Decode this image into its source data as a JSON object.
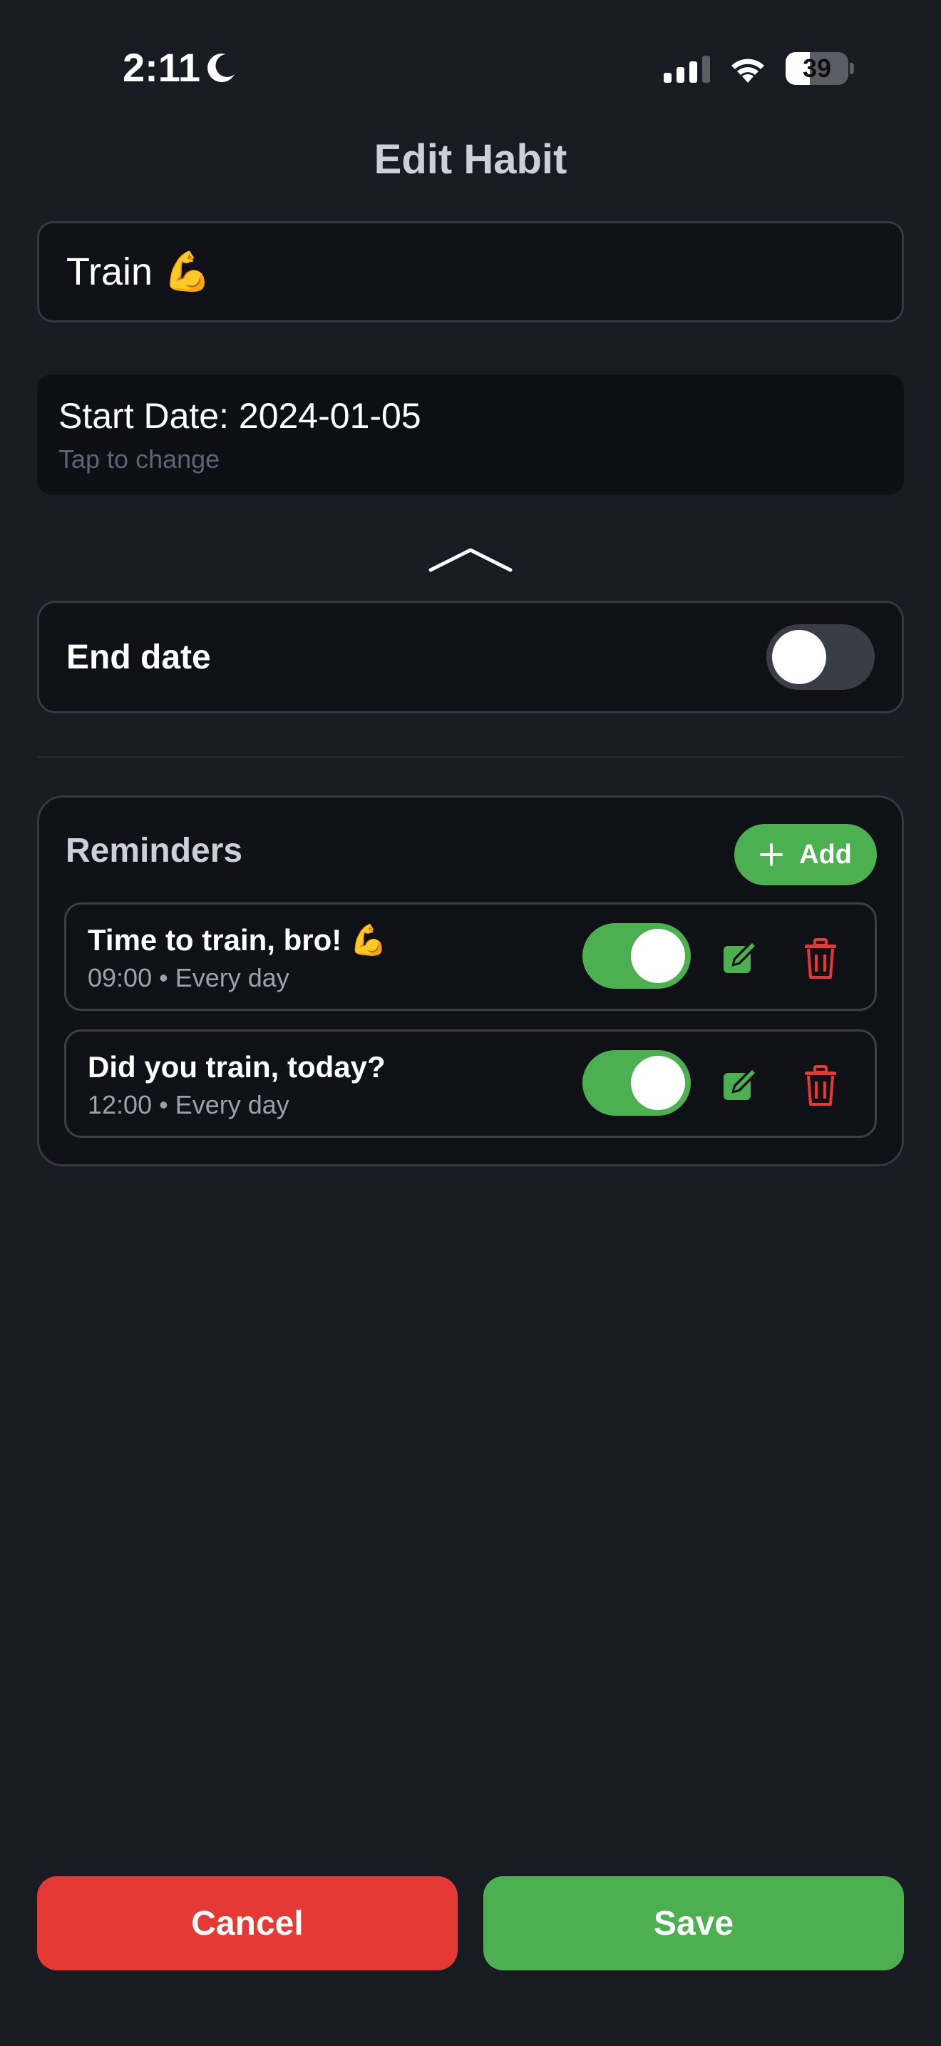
{
  "status_bar": {
    "time": "2:11",
    "battery_percent": "39",
    "battery_level": 0.39,
    "icons": [
      "moon-icon",
      "signal-icon",
      "wifi-icon",
      "battery-icon"
    ]
  },
  "header": {
    "title": "Edit Habit"
  },
  "form": {
    "habit_name": "Train 💪",
    "start_date_label": "Start Date: 2024-01-05",
    "start_date_hint": "Tap to change",
    "end_date_label": "End date",
    "end_date_enabled": false
  },
  "reminders": {
    "title": "Reminders",
    "add_label": "Add",
    "items": [
      {
        "title": "Time to train, bro! 💪",
        "subtitle": "09:00 • Every day",
        "enabled": true
      },
      {
        "title": "Did you train, today?",
        "subtitle": "12:00 • Every day",
        "enabled": true
      }
    ]
  },
  "footer": {
    "cancel_label": "Cancel",
    "save_label": "Save"
  },
  "colors": {
    "background": "#181b22",
    "accent_green": "#4caf50",
    "danger_red": "#e53935"
  }
}
